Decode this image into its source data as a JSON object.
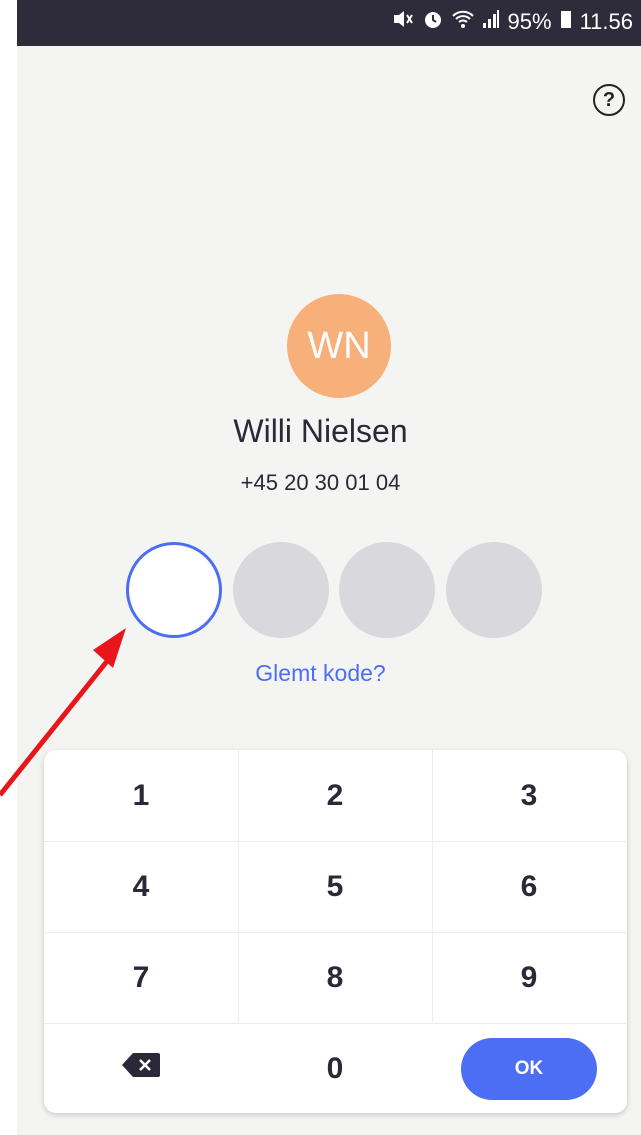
{
  "status_bar": {
    "battery": "95%",
    "time": "11.56"
  },
  "help_label": "?",
  "user": {
    "initials": "WN",
    "name": "Willi Nielsen",
    "phone": "+45 20 30 01 04",
    "avatar_color": "#f7b07a"
  },
  "pin": {
    "length": 4,
    "filled": 0,
    "active_index": 0
  },
  "forgot_code": "Glemt kode?",
  "keypad": {
    "keys": [
      "1",
      "2",
      "3",
      "4",
      "5",
      "6",
      "7",
      "8",
      "9"
    ],
    "zero": "0",
    "backspace_icon": "backspace-icon",
    "ok_label": "OK"
  },
  "colors": {
    "accent": "#4c6ef5",
    "status_bar": "#2e2b3a",
    "annotation_arrow": "#e8161b"
  }
}
